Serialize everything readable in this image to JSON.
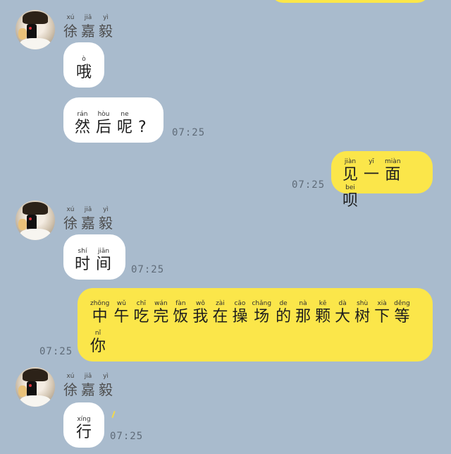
{
  "contact": {
    "name": [
      {
        "hz": "徐",
        "py": "xú"
      },
      {
        "hz": "嘉",
        "py": "jiā"
      },
      {
        "hz": "毅",
        "py": "yì"
      }
    ]
  },
  "messages": [
    {
      "id": "m1",
      "side": "left",
      "chars": [
        {
          "hz": "哦",
          "py": "ò"
        }
      ],
      "time": ""
    },
    {
      "id": "m2",
      "side": "left",
      "chars": [
        {
          "hz": "然",
          "py": "rán"
        },
        {
          "hz": "后",
          "py": "hòu"
        },
        {
          "hz": "呢",
          "py": "ne"
        },
        {
          "hz": "?",
          "py": ""
        }
      ],
      "time": "07:25"
    },
    {
      "id": "m3",
      "side": "right",
      "chars": [
        {
          "hz": "见",
          "py": "jiàn"
        },
        {
          "hz": "一",
          "py": "yī"
        },
        {
          "hz": "面",
          "py": "miàn"
        },
        {
          "hz": "呗",
          "py": "bei"
        }
      ],
      "time": "07:25"
    },
    {
      "id": "m4",
      "side": "left",
      "chars": [
        {
          "hz": "时",
          "py": "shí"
        },
        {
          "hz": "间",
          "py": "jiān"
        }
      ],
      "time": "07:25"
    },
    {
      "id": "m5",
      "side": "right",
      "chars": [
        {
          "hz": "中",
          "py": "zhōng"
        },
        {
          "hz": "午",
          "py": "wǔ"
        },
        {
          "hz": "吃",
          "py": "chī"
        },
        {
          "hz": "完",
          "py": "wán"
        },
        {
          "hz": "饭",
          "py": "fàn"
        },
        {
          "hz": "我",
          "py": "wǒ"
        },
        {
          "hz": "在",
          "py": "zài"
        },
        {
          "hz": "操",
          "py": "cāo"
        },
        {
          "hz": "场",
          "py": "chǎng"
        },
        {
          "hz": "的",
          "py": "de"
        },
        {
          "hz": "那",
          "py": "nà"
        },
        {
          "hz": "颗",
          "py": "kē"
        },
        {
          "hz": "大",
          "py": "dà"
        },
        {
          "hz": "树",
          "py": "shù"
        },
        {
          "hz": "下",
          "py": "xià"
        },
        {
          "hz": "等",
          "py": "děng"
        },
        {
          "hz": "你",
          "py": "nǐ"
        }
      ],
      "time": "07:25"
    },
    {
      "id": "m6",
      "side": "left",
      "chars": [
        {
          "hz": "行",
          "py": "xíng"
        }
      ],
      "time": "07:25"
    }
  ]
}
